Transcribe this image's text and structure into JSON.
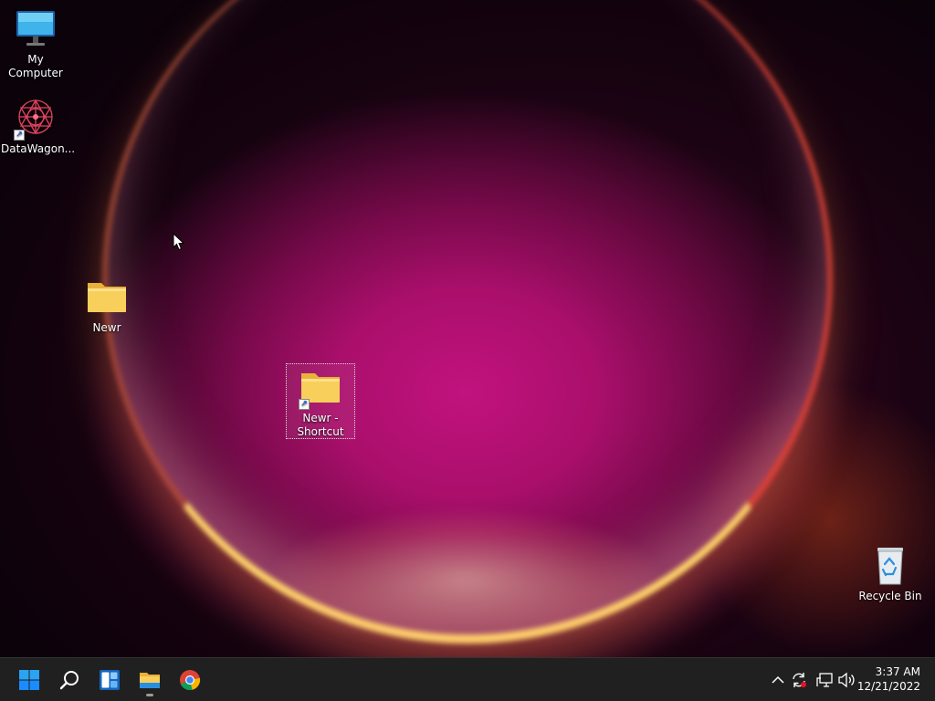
{
  "desktop": {
    "icons": [
      {
        "label": "My Computer",
        "icon": "monitor-icon"
      },
      {
        "label": "DataWagon...",
        "icon": "datawagon-app-icon",
        "shortcut": true
      },
      {
        "label": "Newr",
        "icon": "folder-icon"
      },
      {
        "label": "Newr - Shortcut",
        "icon": "folder-icon",
        "shortcut": true,
        "selected": true
      },
      {
        "label": "Recycle Bin",
        "icon": "recycle-bin-icon"
      }
    ]
  },
  "taskbar": {
    "pinned": [
      {
        "name": "Start",
        "icon": "windows-start-icon"
      },
      {
        "name": "Search",
        "icon": "search-icon"
      },
      {
        "name": "Widgets",
        "icon": "widgets-icon"
      },
      {
        "name": "File Explorer",
        "icon": "file-explorer-icon",
        "running": true
      },
      {
        "name": "Google Chrome",
        "icon": "chrome-icon"
      }
    ],
    "tray": {
      "icons": [
        "chevron-up-icon",
        "sync-icon",
        "network-icon",
        "volume-icon"
      ]
    },
    "clock": {
      "time": "3:37 AM",
      "date": "12/21/2022"
    }
  },
  "colors": {
    "taskbar": "#202020",
    "wallpaper_center": "#c2127e",
    "folder": "#f8cf5a",
    "accent": "#1a8cff"
  }
}
